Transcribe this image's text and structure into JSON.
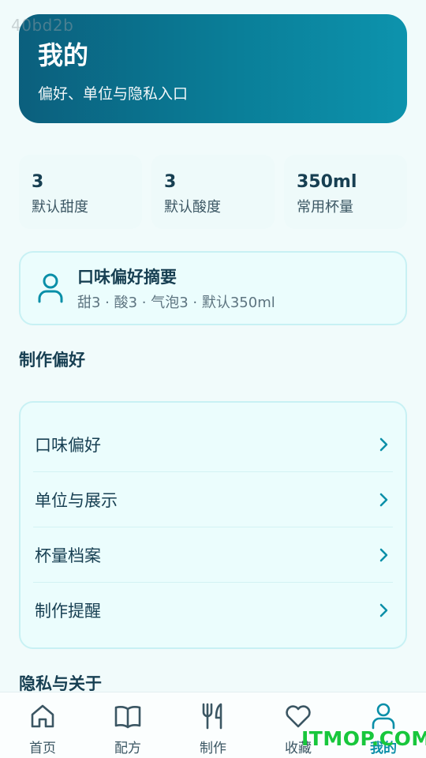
{
  "watermark_top": "40bd2b",
  "watermark_bottom": "ITMOP.COM",
  "header": {
    "title": "我的",
    "subtitle": "偏好、单位与隐私入口"
  },
  "stats": [
    {
      "value": "3",
      "label": "默认甜度"
    },
    {
      "value": "3",
      "label": "默认酸度"
    },
    {
      "value": "350ml",
      "label": "常用杯量"
    }
  ],
  "summary": {
    "icon": "user-icon",
    "title": "口味偏好摘要",
    "desc": "甜3 · 酸3 · 气泡3 · 默认350ml"
  },
  "sections": {
    "prefs": "制作偏好",
    "privacy": "隐私与关于"
  },
  "menu": [
    {
      "label": "口味偏好"
    },
    {
      "label": "单位与展示"
    },
    {
      "label": "杯量档案"
    },
    {
      "label": "制作提醒"
    }
  ],
  "tabs": [
    {
      "label": "首页",
      "icon": "home-icon"
    },
    {
      "label": "配方",
      "icon": "book-icon"
    },
    {
      "label": "制作",
      "icon": "utensils-icon"
    },
    {
      "label": "收藏",
      "icon": "heart-icon"
    },
    {
      "label": "我的",
      "icon": "user-icon",
      "active": true
    }
  ],
  "colors": {
    "accent": "#0a8fa8",
    "header_from": "#0b5f7d",
    "header_to": "#0d93ad"
  }
}
